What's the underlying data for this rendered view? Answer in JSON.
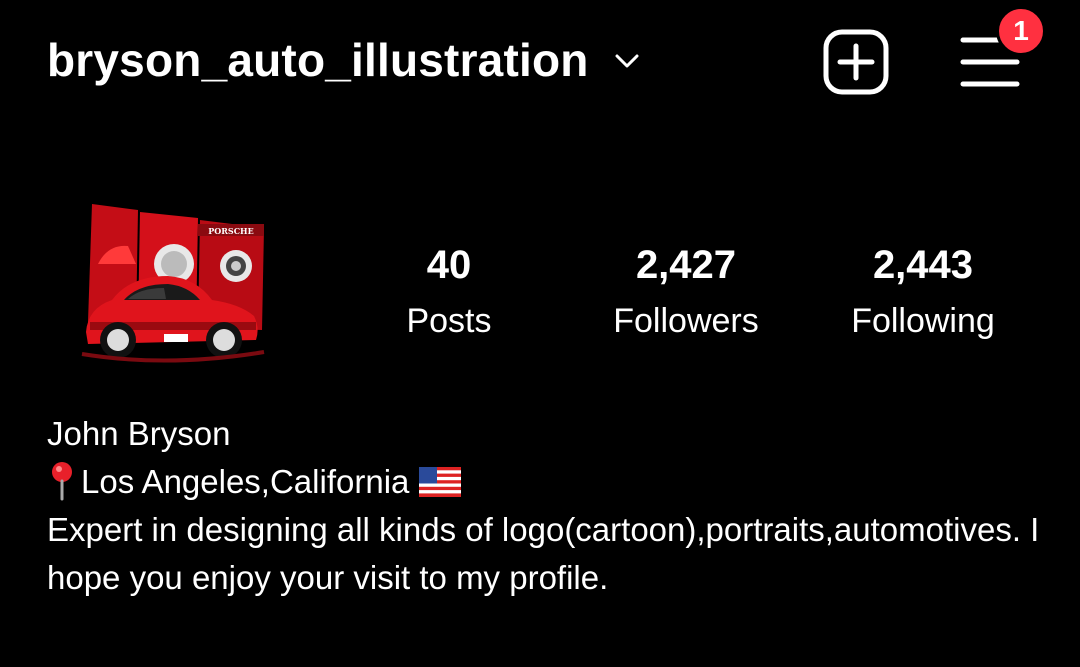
{
  "header": {
    "username": "bryson_auto_illustration",
    "notification_count": "1"
  },
  "profile": {
    "stats": [
      {
        "value": "40",
        "label": "Posts"
      },
      {
        "value": "2,427",
        "label": "Followers"
      },
      {
        "value": "2,443",
        "label": "Following"
      }
    ],
    "avatar_text": "PORSCHE"
  },
  "bio": {
    "name": "John Bryson",
    "location": "Los Angeles,California",
    "description": "Expert in designing all kinds of logo(cartoon),portraits,automotives. I hope you enjoy your visit to my profile."
  },
  "colors": {
    "background": "#000000",
    "text": "#ffffff",
    "badge": "#ff3040",
    "avatar_red": "#d4101a"
  },
  "icons": {
    "chevron": "chevron-down-icon",
    "new_post": "plus-square-icon",
    "menu": "hamburger-menu-icon",
    "location": "map-pin-icon",
    "flag": "us-flag-icon"
  }
}
